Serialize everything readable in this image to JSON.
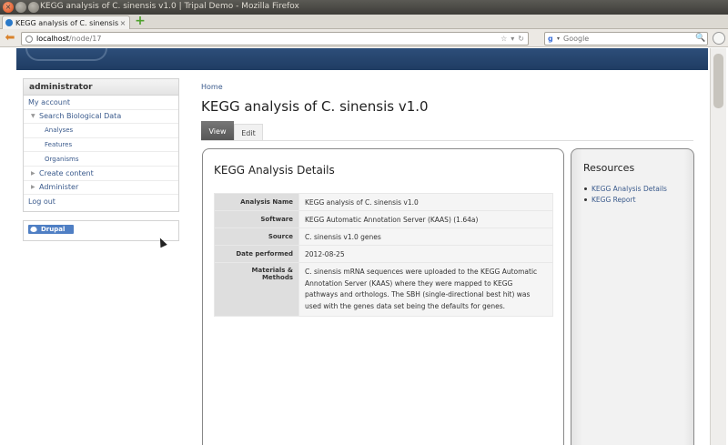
{
  "window": {
    "title": "KEGG analysis of C. sinensis v1.0 | Tripal Demo - Mozilla Firefox"
  },
  "browser": {
    "tab_label": "KEGG analysis of C. sinensis v1...",
    "url_host": "localhost",
    "url_path": "/node/17",
    "search_placeholder": "Google"
  },
  "sidebar": {
    "user_title": "administrator",
    "items": [
      {
        "label": "My account",
        "level": 0
      },
      {
        "label": "Search Biological Data",
        "level": 1
      },
      {
        "label": "Analyses",
        "level": 2
      },
      {
        "label": "Features",
        "level": 2
      },
      {
        "label": "Organisms",
        "level": 2
      },
      {
        "label": "Create content",
        "level": 1
      },
      {
        "label": "Administer",
        "level": 1
      },
      {
        "label": "Log out",
        "level": 0
      }
    ],
    "drupal_badge": "Drupal"
  },
  "content": {
    "breadcrumb": "Home",
    "title": "KEGG analysis of C. sinensis v1.0",
    "tabs": {
      "view": "View",
      "edit": "Edit"
    },
    "details": {
      "heading": "KEGG Analysis Details",
      "rows": [
        {
          "label": "Analysis Name",
          "value": "KEGG analysis of C. sinensis v1.0"
        },
        {
          "label": "Software",
          "value": "KEGG Automatic Annotation Server (KAAS) (1.64a)"
        },
        {
          "label": "Source",
          "value": "C. sinensis v1.0 genes"
        },
        {
          "label": "Date performed",
          "value": "2012-08-25"
        },
        {
          "label": "Materials & Methods",
          "value": "C. sinensis mRNA sequences were uploaded to the KEGG Automatic Annotation Server (KAAS) where they were mapped to KEGG pathways and orthologs. The SBH (single-directional best hit) was used with the genes data set being the defaults for genes."
        }
      ]
    },
    "resources": {
      "heading": "Resources",
      "items": [
        "KEGG Analysis Details",
        "KEGG Report"
      ]
    }
  }
}
